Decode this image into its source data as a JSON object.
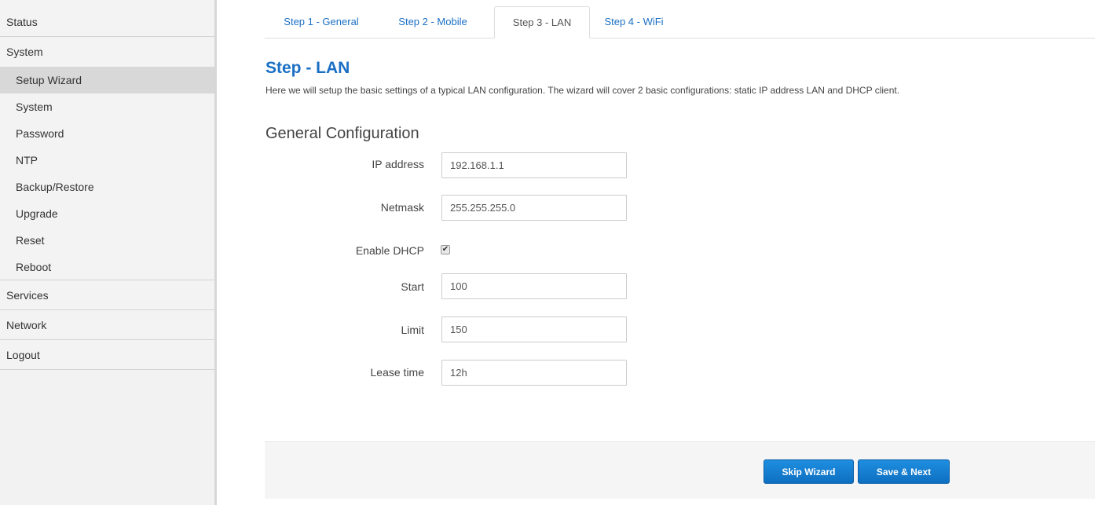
{
  "sidebar": {
    "status": "Status",
    "system": "System",
    "system_items": [
      "Setup Wizard",
      "System",
      "Password",
      "NTP",
      "Backup/Restore",
      "Upgrade",
      "Reset",
      "Reboot"
    ],
    "services": "Services",
    "network": "Network",
    "logout": "Logout"
  },
  "tabs": [
    "Step 1 - General",
    "Step 2 - Mobile",
    "Step 3 - LAN",
    "Step 4 - WiFi"
  ],
  "main": {
    "title": "Step - LAN",
    "description": "Here we will setup the basic settings of a typical LAN configuration. The wizard will cover 2 basic configurations: static IP address LAN and DHCP client.",
    "section_title": "General Configuration"
  },
  "fields": {
    "ip_label": "IP address",
    "ip_value": "192.168.1.1",
    "netmask_label": "Netmask",
    "netmask_value": "255.255.255.0",
    "dhcp_label": "Enable DHCP",
    "dhcp_checked": true,
    "start_label": "Start",
    "start_value": "100",
    "limit_label": "Limit",
    "limit_value": "150",
    "lease_label": "Lease time",
    "lease_value": "12h"
  },
  "footer": {
    "skip_label": "Skip Wizard",
    "save_label": "Save & Next"
  },
  "colors": {
    "accent": "#1a6fc4",
    "button": "#1a7fd0"
  }
}
